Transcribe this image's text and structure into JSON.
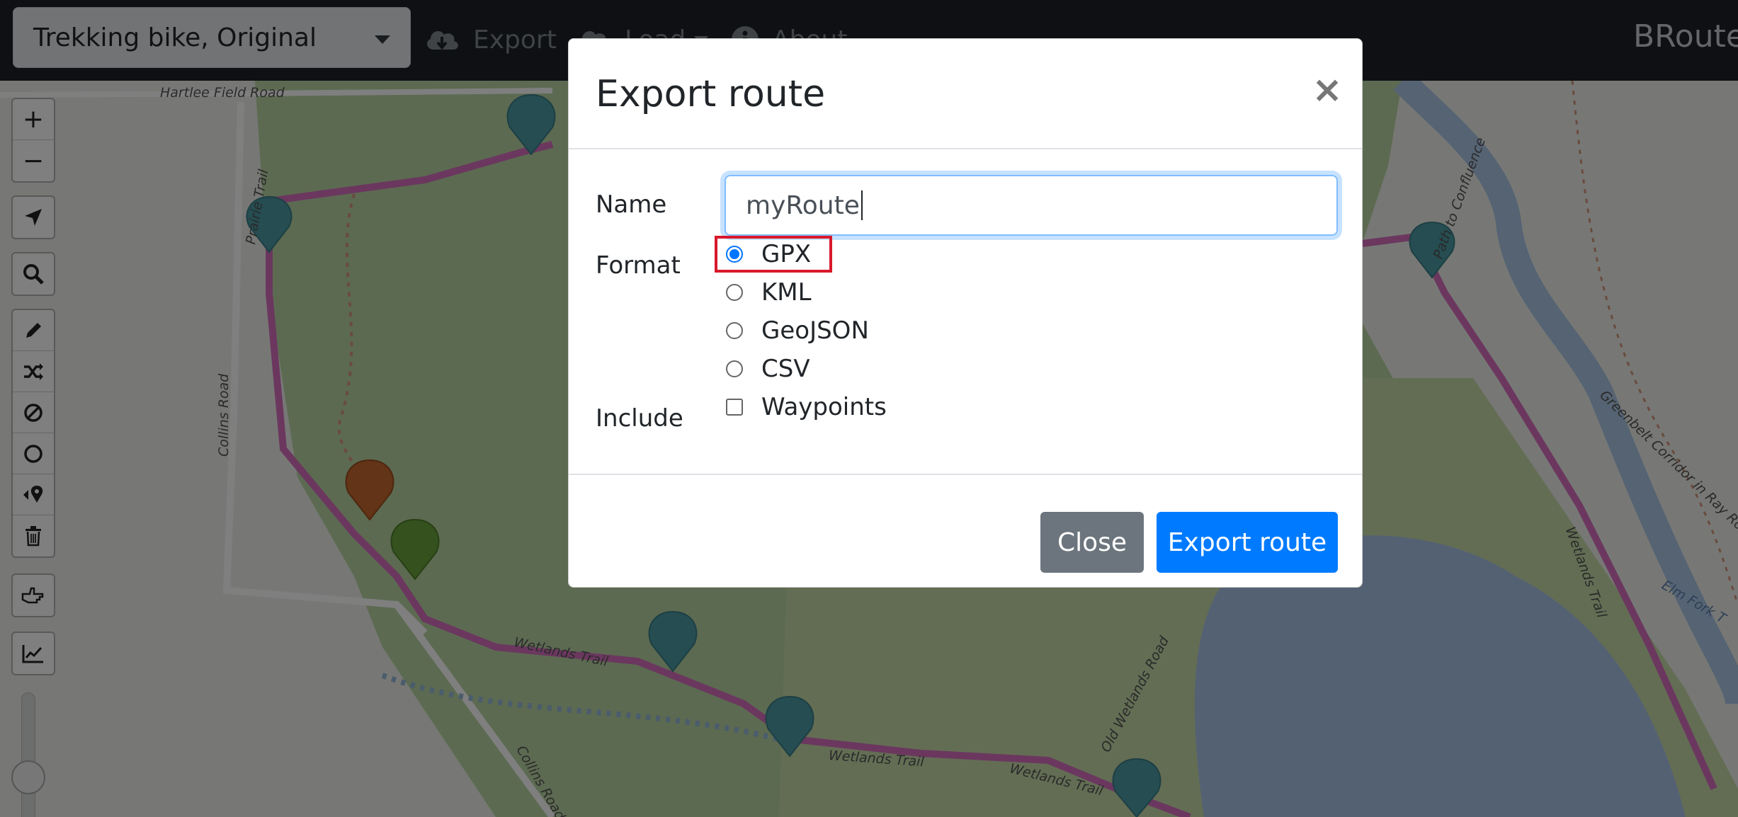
{
  "navbar": {
    "profile_select_value": "Trekking bike, Original",
    "export_label": "Export",
    "load_label": "Load",
    "about_label": "About",
    "brand": "BRouter"
  },
  "map": {
    "labels": {
      "hartlee_field_road": "Hartlee Field Road",
      "collins_road_north": "Collins Road",
      "collins_road_south": "Collins Road",
      "prairie_trail": "Prairie Trail",
      "wetlands_trail_1": "Wetlands Trail",
      "wetlands_trail_2": "Wetlands Trail",
      "wetlands_trail_3": "Wetlands Trail",
      "wetlands_trail_east": "Wetlands Trail",
      "old_wetlands_road": "Old Wetlands Road",
      "path_to_confluence": "Path to Confluence",
      "greenbelt_corridor": "Greenbelt Corridor in Ray Ro",
      "elm_fork": "Elm Fork T"
    }
  },
  "toolbar": {
    "zoom_in": "+",
    "zoom_out": "−"
  },
  "modal": {
    "title": "Export route",
    "close_symbol": "×",
    "name_label": "Name",
    "name_value": "myRoute",
    "format_label": "Format",
    "formats": [
      "GPX",
      "KML",
      "GeoJSON",
      "CSV"
    ],
    "selected_format": "GPX",
    "include_label": "Include",
    "include_option": "Waypoints",
    "include_checked": false,
    "close_button": "Close",
    "export_button": "Export route"
  },
  "colors": {
    "navbar_bg": "#1d2127",
    "primary": "#007bff",
    "secondary": "#6c757d",
    "highlight": "#d8192b",
    "route": "#d76fbf"
  }
}
